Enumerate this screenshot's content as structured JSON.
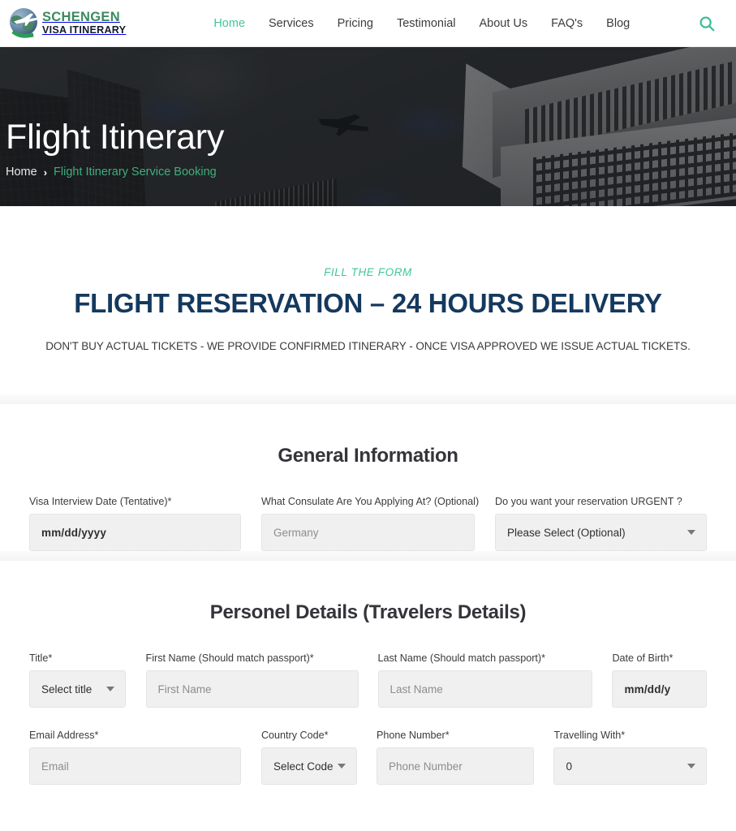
{
  "header": {
    "brand": {
      "line1": "SCHENGEN",
      "line2": "VISA ITINERARY",
      "icon": "globe-plane-logo"
    },
    "nav": [
      {
        "label": "Home",
        "active": true
      },
      {
        "label": "Services",
        "active": false
      },
      {
        "label": "Pricing",
        "active": false
      },
      {
        "label": "Testimonial",
        "active": false
      },
      {
        "label": "About Us",
        "active": false
      },
      {
        "label": "FAQ's",
        "active": false
      },
      {
        "label": "Blog",
        "active": false
      }
    ],
    "search_icon": "search-icon",
    "accent_color": "#3ec79c"
  },
  "hero": {
    "title": "Flight Itinerary",
    "breadcrumb": {
      "home": "Home",
      "separator": "›",
      "current": "Flight Itinerary Service Booking"
    },
    "background": "skyscrapers-and-airplane-photo"
  },
  "intro": {
    "eyebrow": "FILL THE FORM",
    "title": "FLIGHT RESERVATION – 24 HOURS DELIVERY",
    "subtitle": "DON'T BUY ACTUAL TICKETS - WE PROVIDE CONFIRMED ITINERARY - ONCE VISA APPROVED WE ISSUE ACTUAL TICKETS.",
    "title_color": "#15395e",
    "eyebrow_color": "#3ec79c"
  },
  "general_information": {
    "title": "General Information",
    "fields": [
      {
        "label": "Visa Interview Date (Tentative)*",
        "type": "date",
        "value": "mm/dd/yyyy",
        "placeholder": "mm/dd/yyyy"
      },
      {
        "label": "What Consulate Are You Applying At? (Optional)",
        "type": "text",
        "value": "",
        "placeholder": "Germany"
      },
      {
        "label": "Do you want your reservation URGENT ?",
        "type": "select",
        "value": "Please Select (Optional)",
        "placeholder": "Please Select (Optional)"
      }
    ]
  },
  "personal_details": {
    "title": "Personel Details (Travelers Details)",
    "row1": [
      {
        "label": "Title*",
        "type": "select",
        "value": "Select title",
        "placeholder": "Select title"
      },
      {
        "label": "First Name (Should match passport)*",
        "type": "text",
        "value": "",
        "placeholder": "First Name"
      },
      {
        "label": "Last Name (Should match passport)*",
        "type": "text",
        "value": "",
        "placeholder": "Last Name"
      },
      {
        "label": "Date of Birth*",
        "type": "date",
        "value": "mm/dd/y",
        "placeholder": "mm/dd/y"
      }
    ],
    "row2": [
      {
        "label": "Email Address*",
        "type": "email",
        "value": "",
        "placeholder": "Email"
      },
      {
        "label": "Country Code*",
        "type": "select",
        "value": "Select Code",
        "placeholder": "Select Code"
      },
      {
        "label": "Phone Number*",
        "type": "tel",
        "value": "",
        "placeholder": "Phone Number"
      },
      {
        "label": "Travelling With*",
        "type": "select",
        "value": "0",
        "placeholder": "0"
      }
    ]
  }
}
